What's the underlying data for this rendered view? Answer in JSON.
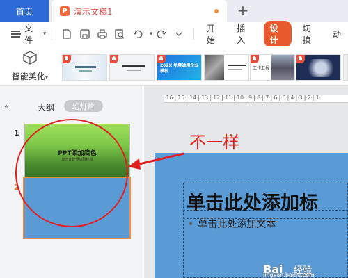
{
  "tabs": {
    "home_label": "首页",
    "doc_label": "演示文稿1",
    "doc_icon_letter": "P",
    "new_tab_symbol": "+"
  },
  "menu": {
    "file_label": "文件",
    "items": [
      "开始",
      "插入",
      "设计",
      "切换",
      "动"
    ],
    "active": "设计",
    "accent_color": "#e85a2c",
    "toolbar_icons": [
      "new-doc-icon",
      "save-icon",
      "print-icon",
      "print-preview-icon",
      "undo-icon",
      "redo-icon",
      "more-dropdown-icon"
    ]
  },
  "ribbon": {
    "beautify_label": "智能美化",
    "templates": [
      {
        "text": "",
        "theme": "light-floral"
      },
      {
        "text": "",
        "theme": "light-gray"
      },
      {
        "text": "202X 年度通用企业模板",
        "theme": "blue"
      },
      {
        "text": "",
        "theme": "white-photo"
      },
      {
        "text": "工作汇报",
        "theme": "city-photo"
      },
      {
        "text": "",
        "theme": "dark-navy"
      }
    ]
  },
  "sidebar": {
    "tab_outline": "大纲",
    "tab_slides": "幻灯片",
    "collapse_icon": "«",
    "slides": [
      {
        "number": "1",
        "title": "PPT添加底色",
        "subtitle": "单击此处添加副标题"
      },
      {
        "number": "2",
        "title": "",
        "subtitle": ""
      }
    ]
  },
  "ruler": {
    "text": "·16·|·15·|·14·|·13·|·12·|·11·|·10·|·9·|·8·|·7·|·6·|·5·|·4·|·3·|·2·|·1·"
  },
  "editor": {
    "title_placeholder": "单击此处添加标",
    "body_placeholder": "单击此处添加文本",
    "bullet": "•",
    "slide_color": "#5b9bd5"
  },
  "annotation": {
    "text": "不一样",
    "color": "#e02020"
  },
  "watermark": {
    "logo": "Bai",
    "name": "经验",
    "url": "jingyan.baidu.com"
  }
}
